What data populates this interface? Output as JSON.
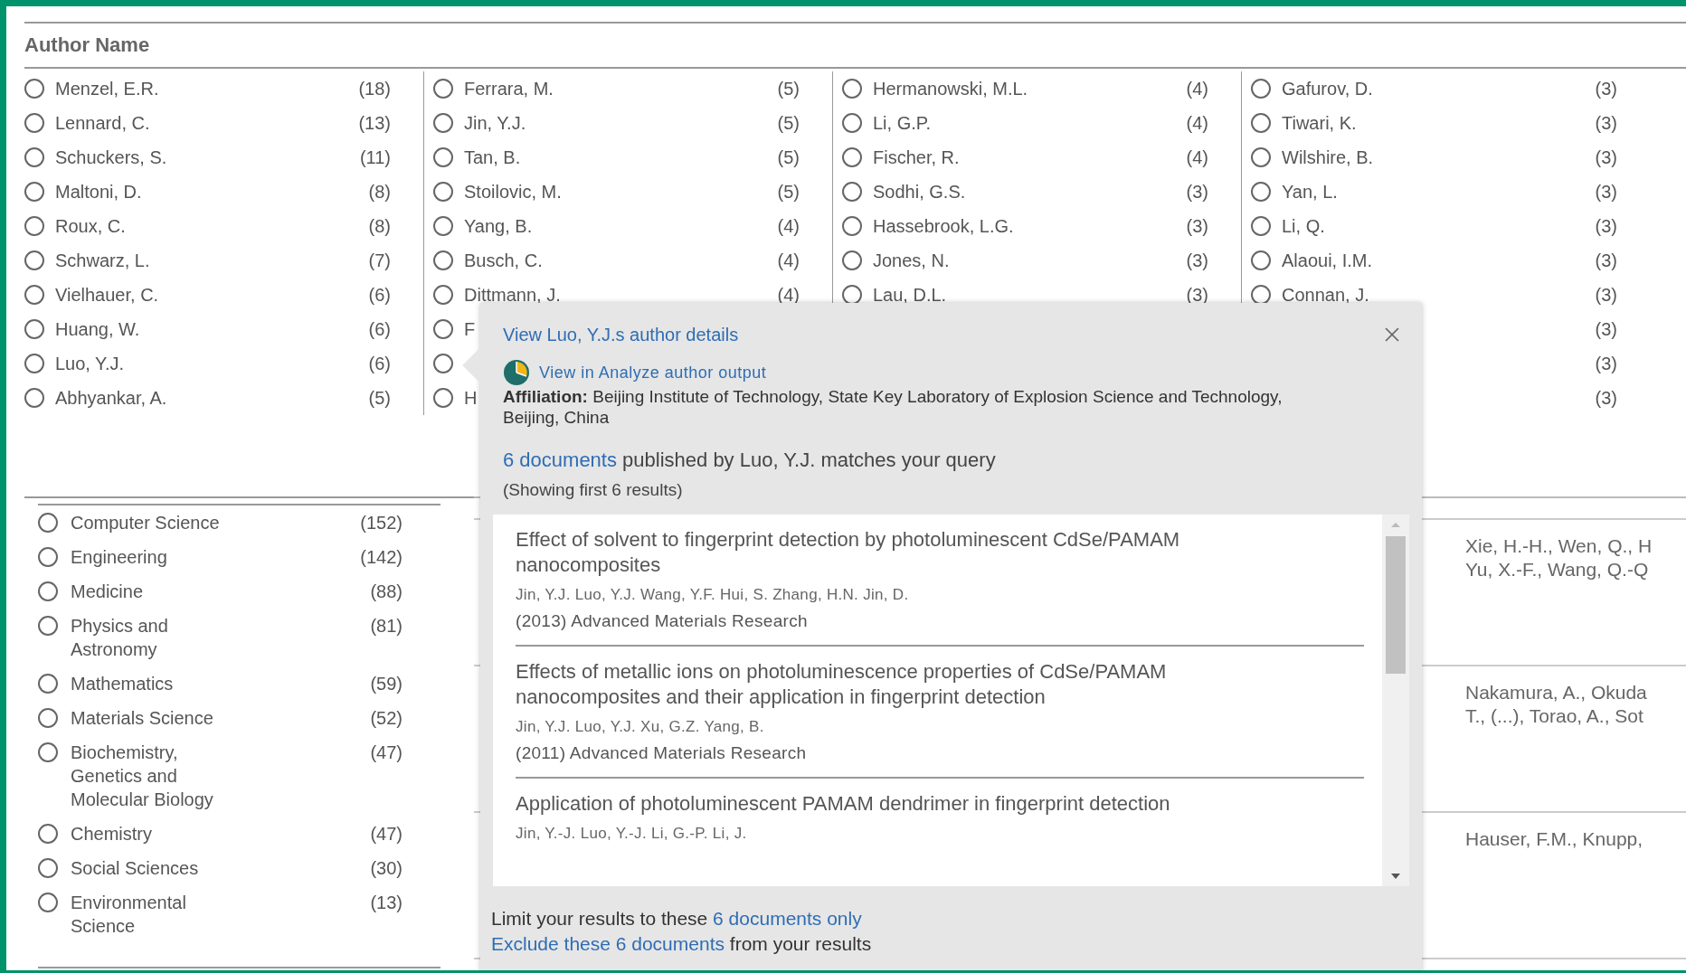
{
  "author_facet": {
    "title": "Author Name",
    "columns": [
      [
        {
          "name": "Menzel, E.R.",
          "count": "(18)",
          "checked": false
        },
        {
          "name": "Lennard, C.",
          "count": "(13)",
          "checked": false
        },
        {
          "name": "Schuckers, S.",
          "count": "(11)",
          "checked": false
        },
        {
          "name": "Maltoni, D.",
          "count": "(8)",
          "checked": false
        },
        {
          "name": "Roux, C.",
          "count": "(8)",
          "checked": false
        },
        {
          "name": "Schwarz, L.",
          "count": "(7)",
          "checked": false
        },
        {
          "name": "Vielhauer, C.",
          "count": "(6)",
          "checked": false
        },
        {
          "name": "Huang, W.",
          "count": "(6)",
          "checked": false
        },
        {
          "name": "Luo, Y.J.",
          "count": "(6)",
          "checked": false
        },
        {
          "name": "Abhyankar, A.",
          "count": "(5)",
          "checked": false
        }
      ],
      [
        {
          "name": "Ferrara, M.",
          "count": "(5)",
          "checked": false
        },
        {
          "name": "Jin, Y.J.",
          "count": "(5)",
          "checked": false
        },
        {
          "name": "Tan, B.",
          "count": "(5)",
          "checked": false
        },
        {
          "name": "Stoilovic, M.",
          "count": "(5)",
          "checked": false
        },
        {
          "name": "Yang, B.",
          "count": "(4)",
          "checked": false
        },
        {
          "name": "Busch, C.",
          "count": "(4)",
          "checked": false
        },
        {
          "name": "Dittmann, J.",
          "count": "(4)",
          "checked": false
        },
        {
          "name": "F",
          "checked": false
        },
        {
          "checked": false
        },
        {
          "name": "H",
          "checked": false
        }
      ],
      [
        {
          "name": "Hermanowski, M.L.",
          "count": "(4)",
          "checked": false
        },
        {
          "name": "Li, G.P.",
          "count": "(4)",
          "checked": false
        },
        {
          "name": "Fischer, R.",
          "count": "(4)",
          "checked": false
        },
        {
          "name": "Sodhi, G.S.",
          "count": "(3)",
          "checked": false
        },
        {
          "name": "Hassebrook, L.G.",
          "count": "(3)",
          "checked": false
        },
        {
          "name": "Jones, N.",
          "count": "(3)",
          "checked": false
        },
        {
          "name": "Lau, D.L.",
          "count": "(3)",
          "checked": false
        }
      ],
      [
        {
          "name": "Gafurov, D.",
          "count": "(3)",
          "checked": false
        },
        {
          "name": "Tiwari, K.",
          "count": "(3)",
          "checked": false
        },
        {
          "name": "Wilshire, B.",
          "count": "(3)",
          "checked": false
        },
        {
          "name": "Yan, L.",
          "count": "(3)",
          "checked": false
        },
        {
          "name": "Li, Q.",
          "count": "(3)",
          "checked": false
        },
        {
          "name": "Alaoui, I.M.",
          "count": "(3)",
          "checked": false
        },
        {
          "name": "Connan, J.",
          "count": "(3)",
          "checked": false
        },
        {
          "count": "(3)"
        },
        {
          "count": "(3)"
        },
        {
          "count": "(3)"
        }
      ]
    ]
  },
  "subject_facet": {
    "items": [
      {
        "name": "Computer Science",
        "count": "(152)",
        "checked": false
      },
      {
        "name": "Engineering",
        "count": "(142)",
        "checked": false
      },
      {
        "name": "Medicine",
        "count": "(88)",
        "checked": false
      },
      {
        "name": "Physics and Astronomy",
        "count": "(81)",
        "checked": false
      },
      {
        "name": "Mathematics",
        "count": "(59)",
        "checked": false
      },
      {
        "name": "Materials Science",
        "count": "(52)",
        "checked": false
      },
      {
        "name": "Biochemistry, Genetics and Molecular Biology",
        "count": "(47)",
        "checked": false
      },
      {
        "name": "Chemistry",
        "count": "(47)",
        "checked": false
      },
      {
        "name": "Social Sciences",
        "count": "(30)",
        "checked": false
      },
      {
        "name": "Environmental Science",
        "count": "(13)",
        "checked": false
      }
    ]
  },
  "results": {
    "rows": [
      {
        "authors": [
          "Xie, H.-H., Wen, Q., H",
          "Yu, X.-F., Wang, Q.-Q"
        ]
      },
      {
        "authors": [
          "Nakamura, A., Okuda",
          "T., (...), Torao, A., Sot"
        ]
      },
      {
        "authors": [
          "Hauser, F.M., Knupp,"
        ]
      }
    ]
  },
  "popup": {
    "details_link": "View Luo, Y.J.s author details",
    "analyze_link": "View in Analyze author output",
    "affiliation": "**Affiliation:** Beijing Institute of Technology, State Key Laboratory of Explosion Science and Technology, Beijing, China",
    "summary": [
      {
        "text": "6 documents",
        "link": true
      },
      {
        "text": " published by Luo, Y.J. matches your query",
        "link": false
      }
    ],
    "showing": "(Showing first 6 results)",
    "documents": [
      {
        "title": "Effect of solvent to fingerprint detection by photoluminescent CdSe/PAMAM nanocomposites",
        "authors": "Jin, Y.J. Luo, Y.J. Wang, Y.F. Hui, S. Zhang, H.N. Jin, D.",
        "source": "(2013) Advanced Materials Research"
      },
      {
        "title": "Effects of metallic ions on photoluminescence properties of CdSe/PAMAM nanocomposites and their application in fingerprint detection",
        "authors": "Jin, Y.J. Luo, Y.J. Xu, G.Z. Yang, B.",
        "source": "(2011) Advanced Materials Research"
      },
      {
        "title": "Application of photoluminescent PAMAM dendrimer in fingerprint detection",
        "authors": "Jin, Y.-J. Luo, Y.-J. Li, G.-P. Li, J."
      }
    ],
    "actions": [
      [
        {
          "text": "Limit your results to these ",
          "link": false
        },
        {
          "text": "6 documents only",
          "link": true
        }
      ],
      [
        {
          "text": "Exclude these 6 documents",
          "link": true
        },
        {
          "text": " from your results",
          "link": false
        }
      ]
    ]
  }
}
